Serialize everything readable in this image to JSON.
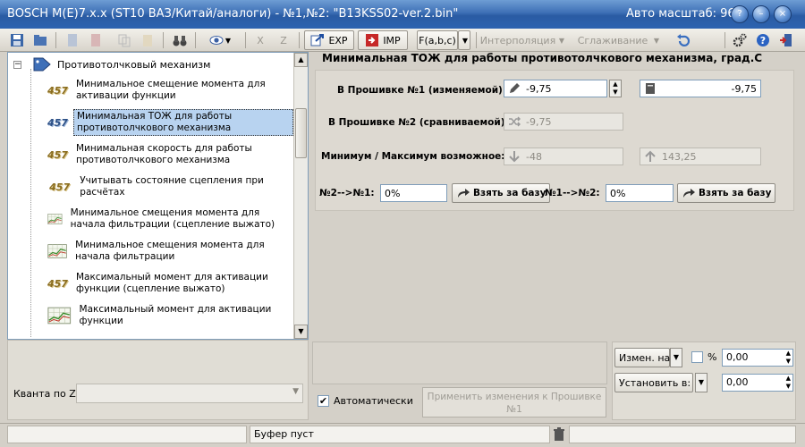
{
  "window": {
    "title": "BOSCH M(E)7.x.x (ST10 ВАЗ/Китай/аналоги) - №1,№2: \"B13KSS02-ver.2.bin\"",
    "auto_scale_label": "Авто масштаб: 96"
  },
  "toolbar": {
    "exp_label": "EXP",
    "imp_label": "IMP",
    "func_label": "F(a,b,c)",
    "x_label": "X",
    "z_label": "Z",
    "interpolation_label": "Интерполяция",
    "smoothing_label": "Сглаживание"
  },
  "tree": {
    "root_label": "Противотолчковый механизм",
    "items": [
      {
        "label": "Минимальное смещение момента для активации функции",
        "icon": "457-icon"
      },
      {
        "label": "Минимальная ТОЖ для работы противотолчкового механизма",
        "icon": "457-icon"
      },
      {
        "label": "Минимальная скорость для работы противотолчкового механизма",
        "icon": "457-icon"
      },
      {
        "label": "Учитывать состояние сцепления при расчётах",
        "icon": "457-icon"
      },
      {
        "label": "Минимальное смещения момента для начала фильтрации (сцепление выжато)",
        "icon": "chart-icon"
      },
      {
        "label": "Минимальное смещения момента для начала фильтрации",
        "icon": "chart-icon"
      },
      {
        "label": "Максимальный момент для активации функции (сцепление выжато)",
        "icon": "457-icon"
      },
      {
        "label": "Максимальный момент для активации функции",
        "icon": "chart-icon"
      }
    ],
    "icon_text": "457"
  },
  "param": {
    "title": "Минимальная ТОЖ для работы противотолчкового механизма, град.С",
    "fw1_label": "В Прошивке №1 (изменяемой):",
    "fw1_value": "-9,75",
    "fw1_orig_value": "-9,75",
    "fw2_label": "В Прошивке №2 (сравниваемой):",
    "fw2_value": "-9,75",
    "minmax_label": "Минимум / Максимум возможное:",
    "min_value": "-48",
    "max_value": "143,25",
    "n2n1_label": "№2-->№1:",
    "n2n1_value": "0%",
    "n1n2_label": "№1-->№2:",
    "n1n2_value": "0%",
    "take_base_label": "Взять за базу"
  },
  "bottom": {
    "quant_label": "Кванта по Z:",
    "auto_label": "Автоматически",
    "auto_checked": true,
    "apply_label": "Применить изменения к Прошивке №1",
    "change_by_label": "Измен. на:",
    "percent_label": "%",
    "change_value": "0,00",
    "set_to_label": "Установить в:",
    "set_value": "0,00"
  },
  "statusbar": {
    "buffer_text": "Буфер пуст"
  }
}
